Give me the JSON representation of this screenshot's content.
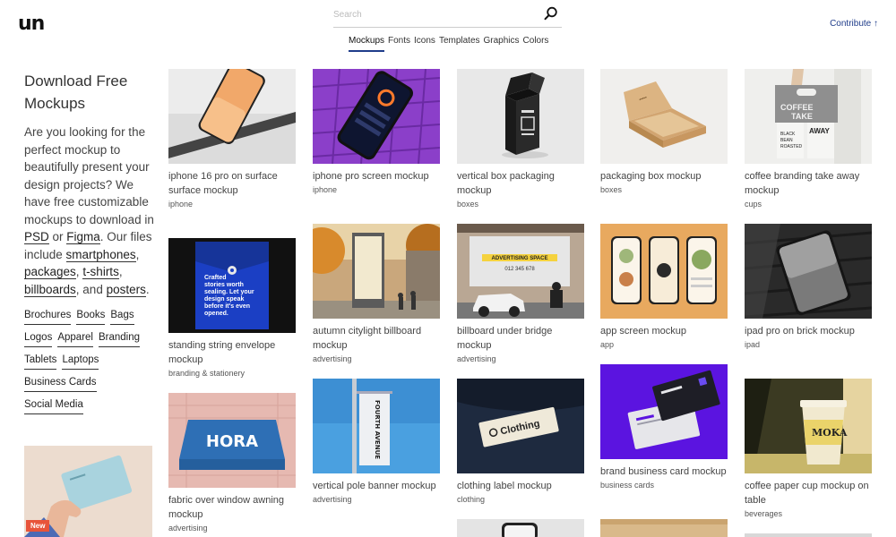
{
  "header": {
    "logo": "un",
    "search_placeholder": "Search",
    "nav": [
      "Mockups",
      "Fonts",
      "Icons",
      "Templates",
      "Graphics",
      "Colors"
    ],
    "active_nav": "Mockups",
    "contribute": "Contribute ↑"
  },
  "sidebar": {
    "title": "Download Free Mockups",
    "intro_1": "Are you looking for the perfect mockup to beautifully present your design projects? We have free customizable mockups to download in ",
    "link_psd": "PSD",
    "or": " or ",
    "link_figma": "Figma",
    "intro_2": ". Our files include ",
    "link_smartphones": "smartphones",
    "link_packages": "packages",
    "link_tshirts": "t-shirts",
    "link_billboards": "billboards",
    "and": ", and ",
    "link_posters": "posters",
    "categories": [
      "Brochures",
      "Books",
      "Bags",
      "Logos",
      "Apparel",
      "Branding",
      "Tablets",
      "Laptops",
      "Business Cards",
      "Social Media"
    ],
    "promo_badge": "New"
  },
  "cards": [
    {
      "title": "iphone 16 pro on surface surface mockup",
      "tag": "iphone"
    },
    {
      "title": "iphone pro screen mockup",
      "tag": "iphone"
    },
    {
      "title": "vertical box packaging mockup",
      "tag": "boxes"
    },
    {
      "title": "packaging box mockup",
      "tag": "boxes"
    },
    {
      "title": "coffee branding take away mockup",
      "tag": "cups"
    },
    {
      "title": "standing string envelope mockup",
      "tag": "branding & stationery"
    },
    {
      "title": "autumn citylight billboard mockup",
      "tag": "advertising"
    },
    {
      "title": "billboard under bridge mockup",
      "tag": "advertising"
    },
    {
      "title": "app screen mockup",
      "tag": "app"
    },
    {
      "title": "ipad pro on brick mockup",
      "tag": "ipad"
    },
    {
      "title": "fabric over window awning mockup",
      "tag": "advertising"
    },
    {
      "title": "vertical pole banner mockup",
      "tag": "advertising"
    },
    {
      "title": "clothing label mockup",
      "tag": "clothing"
    },
    {
      "title": "brand business card mockup",
      "tag": "business cards"
    },
    {
      "title": "coffee paper cup mockup on table",
      "tag": "beverages"
    }
  ],
  "image_text": {
    "envelope": [
      "Crafted",
      "stories worth",
      "sealing. Let your",
      "design speak",
      "before it's even",
      "opened."
    ],
    "billboard": "ADVERTISING SPACE",
    "billboard_phone": "012 345 678",
    "awning": "HORA",
    "banner": "FOURTH AVENUE",
    "clothing_label": "Clothing",
    "cup_top": [
      "COFFEE",
      "TAKE",
      "AWAY"
    ],
    "cup_side": [
      "BLACK",
      "BEAN",
      "ROASTED"
    ],
    "cup_sleeve": "MOKA"
  }
}
